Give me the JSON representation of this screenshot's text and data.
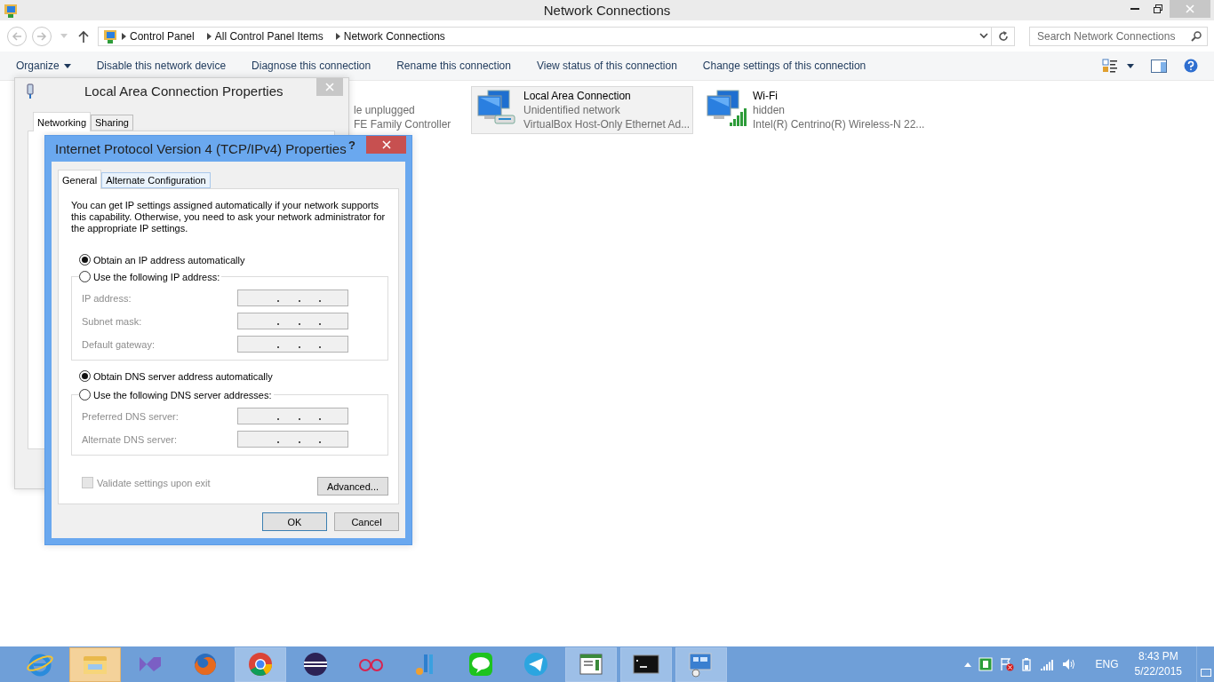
{
  "window": {
    "title": "Network Connections"
  },
  "address_bar": {
    "crumbs": [
      "Control Panel",
      "All Control Panel Items",
      "Network Connections"
    ]
  },
  "search": {
    "placeholder": "Search Network Connections"
  },
  "toolbar": {
    "items": [
      {
        "label": "Organize",
        "kind": "menu"
      },
      {
        "label": "Disable this network device",
        "kind": "command"
      },
      {
        "label": "Diagnose this connection",
        "kind": "command"
      },
      {
        "label": "Rename this connection",
        "kind": "command"
      },
      {
        "label": "View status of this connection",
        "kind": "command"
      },
      {
        "label": "Change settings of this connection",
        "kind": "command"
      }
    ]
  },
  "connections": [
    {
      "kind": "partial",
      "status": "le unplugged",
      "adapter": "FE Family Controller",
      "selected": false
    },
    {
      "kind": "ethernet",
      "name": "Local Area Connection",
      "status": "Unidentified network",
      "adapter": "VirtualBox Host-Only Ethernet Ad...",
      "selected": true
    },
    {
      "kind": "wifi",
      "name": "Wi-Fi",
      "status": "hidden",
      "adapter": "Intel(R) Centrino(R) Wireless-N 22...",
      "selected": false
    }
  ],
  "lac_dialog": {
    "title": "Local Area Connection Properties",
    "tabs": [
      {
        "label": "Networking",
        "selected": true
      },
      {
        "label": "Sharing",
        "selected": false
      }
    ]
  },
  "ipv4_dialog": {
    "title": "Internet Protocol Version 4 (TCP/IPv4) Properties",
    "help": "?",
    "tabs": [
      {
        "label": "General",
        "selected": true
      },
      {
        "label": "Alternate Configuration",
        "selected": false
      }
    ],
    "intro": "You can get IP settings assigned automatically if your network supports this capability. Otherwise, you need to ask your network administrator for the appropriate IP settings.",
    "ip_options": [
      {
        "label": "Obtain an IP address automatically",
        "selected": true
      },
      {
        "label": "Use the following IP address:",
        "selected": false
      }
    ],
    "ip_fields": [
      {
        "label": "IP address:",
        "disabled": true
      },
      {
        "label": "Subnet mask:",
        "disabled": true
      },
      {
        "label": "Default gateway:",
        "disabled": true
      }
    ],
    "dns_options": [
      {
        "label": "Obtain DNS server address automatically",
        "selected": true
      },
      {
        "label": "Use the following DNS server addresses:",
        "selected": false
      }
    ],
    "dns_fields": [
      {
        "label": "Preferred DNS server:",
        "disabled": true
      },
      {
        "label": "Alternate DNS server:",
        "disabled": true
      }
    ],
    "validate": {
      "label": "Validate settings upon exit",
      "checked": false,
      "disabled": true
    },
    "advanced": "Advanced...",
    "buttons": [
      {
        "label": "OK",
        "kind": "default"
      },
      {
        "label": "Cancel",
        "kind": "normal"
      }
    ]
  },
  "taskbar": {
    "apps": [
      {
        "kind": "ie",
        "selected": false,
        "running": false
      },
      {
        "kind": "explorer",
        "selected": true,
        "running": true
      },
      {
        "kind": "vs",
        "selected": false,
        "running": false
      },
      {
        "kind": "firefox",
        "selected": false,
        "running": false
      },
      {
        "kind": "chrome",
        "selected": false,
        "running": true
      },
      {
        "kind": "eclipse",
        "selected": false,
        "running": false
      },
      {
        "kind": "rings",
        "selected": false,
        "running": false
      },
      {
        "kind": "ide",
        "selected": false,
        "running": false
      },
      {
        "kind": "line",
        "selected": false,
        "running": false
      },
      {
        "kind": "telegram",
        "selected": false,
        "running": false
      },
      {
        "kind": "notes",
        "selected": false,
        "running": true
      },
      {
        "kind": "cmd",
        "selected": false,
        "running": true
      },
      {
        "kind": "netpanel",
        "selected": false,
        "running": true
      }
    ],
    "language": "ENG",
    "time": "8:43 PM",
    "date": "5/22/2015"
  }
}
